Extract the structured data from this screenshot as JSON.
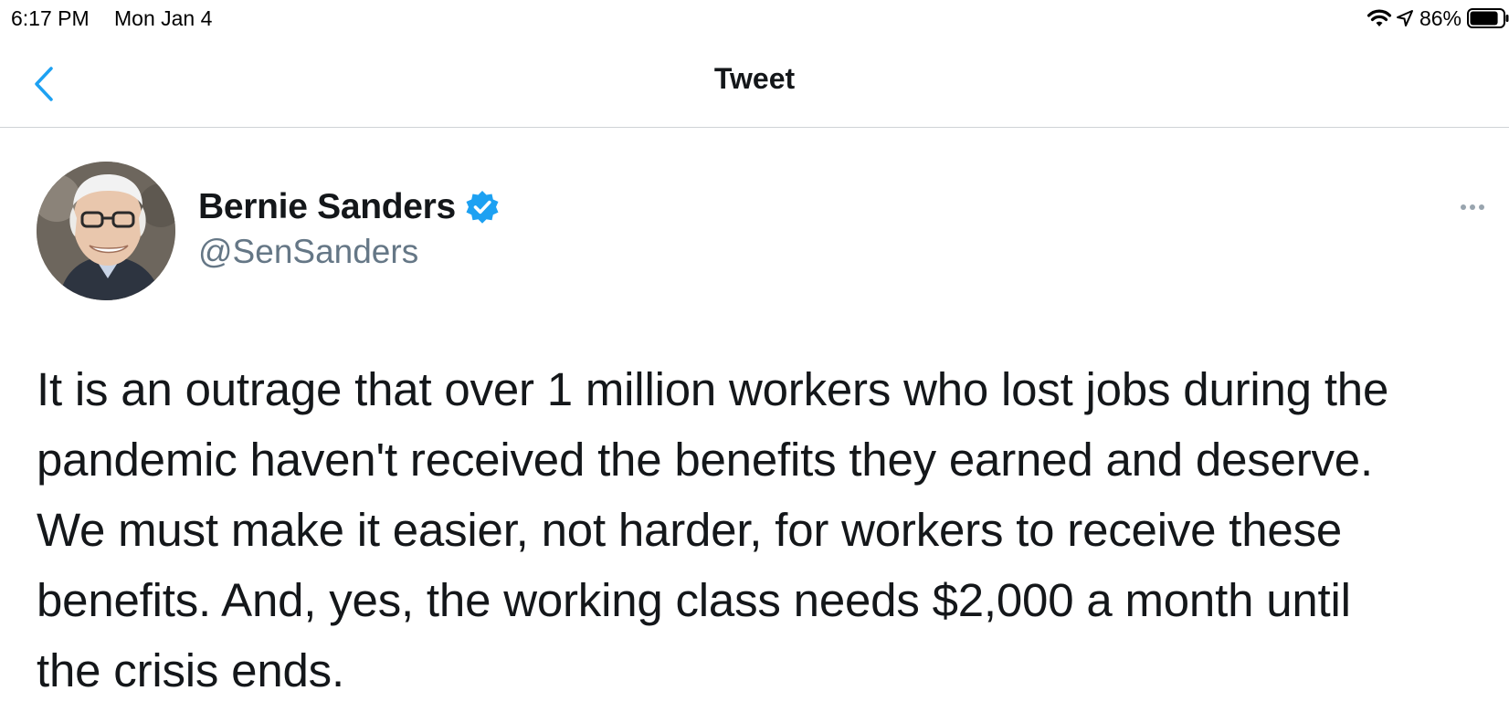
{
  "status_bar": {
    "time": "6:17 PM",
    "date": "Mon Jan 4",
    "battery_percent": "86%",
    "battery_level": 0.86,
    "icons": [
      "wifi-icon",
      "location-arrow-icon",
      "battery-icon"
    ]
  },
  "nav": {
    "title": "Tweet",
    "back_icon": "chevron-left-icon",
    "accent_color": "#1da1f2"
  },
  "tweet": {
    "author_name": "Bernie Sanders",
    "author_handle": "@SenSanders",
    "verified": true,
    "verified_icon": "verified-badge-icon",
    "more_icon": "ellipsis-icon",
    "lines": [
      "It is an outrage that over 1 million workers who lost jobs during the",
      "pandemic haven't received the benefits they earned and deserve.",
      "We must make it easier, not harder, for workers to receive these",
      "benefits. And, yes, the working class needs $2,000 a month until",
      "the crisis ends."
    ]
  },
  "colors": {
    "text_primary": "#14171a",
    "text_secondary": "#657786",
    "verified_blue": "#1da1f2",
    "divider": "#cfd3d6"
  }
}
